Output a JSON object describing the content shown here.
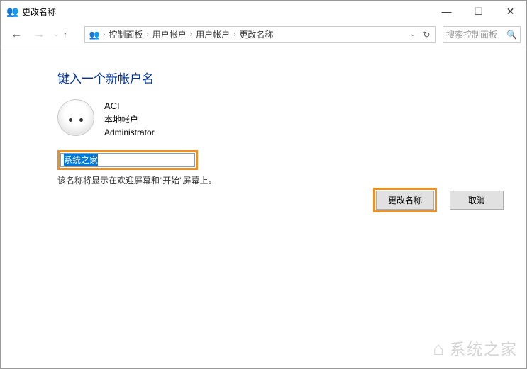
{
  "window": {
    "title": "更改名称"
  },
  "breadcrumb": {
    "items": [
      "控制面板",
      "用户帐户",
      "用户帐户",
      "更改名称"
    ]
  },
  "search": {
    "placeholder": "搜索控制面板"
  },
  "main": {
    "heading": "键入一个新帐户名",
    "account": {
      "name": "ACI",
      "type": "本地帐户",
      "role": "Administrator"
    },
    "input_value": "系统之家",
    "hint": "该名称将显示在欢迎屏幕和\"开始\"屏幕上。"
  },
  "buttons": {
    "confirm": "更改名称",
    "cancel": "取消"
  },
  "watermark": "系统之家"
}
